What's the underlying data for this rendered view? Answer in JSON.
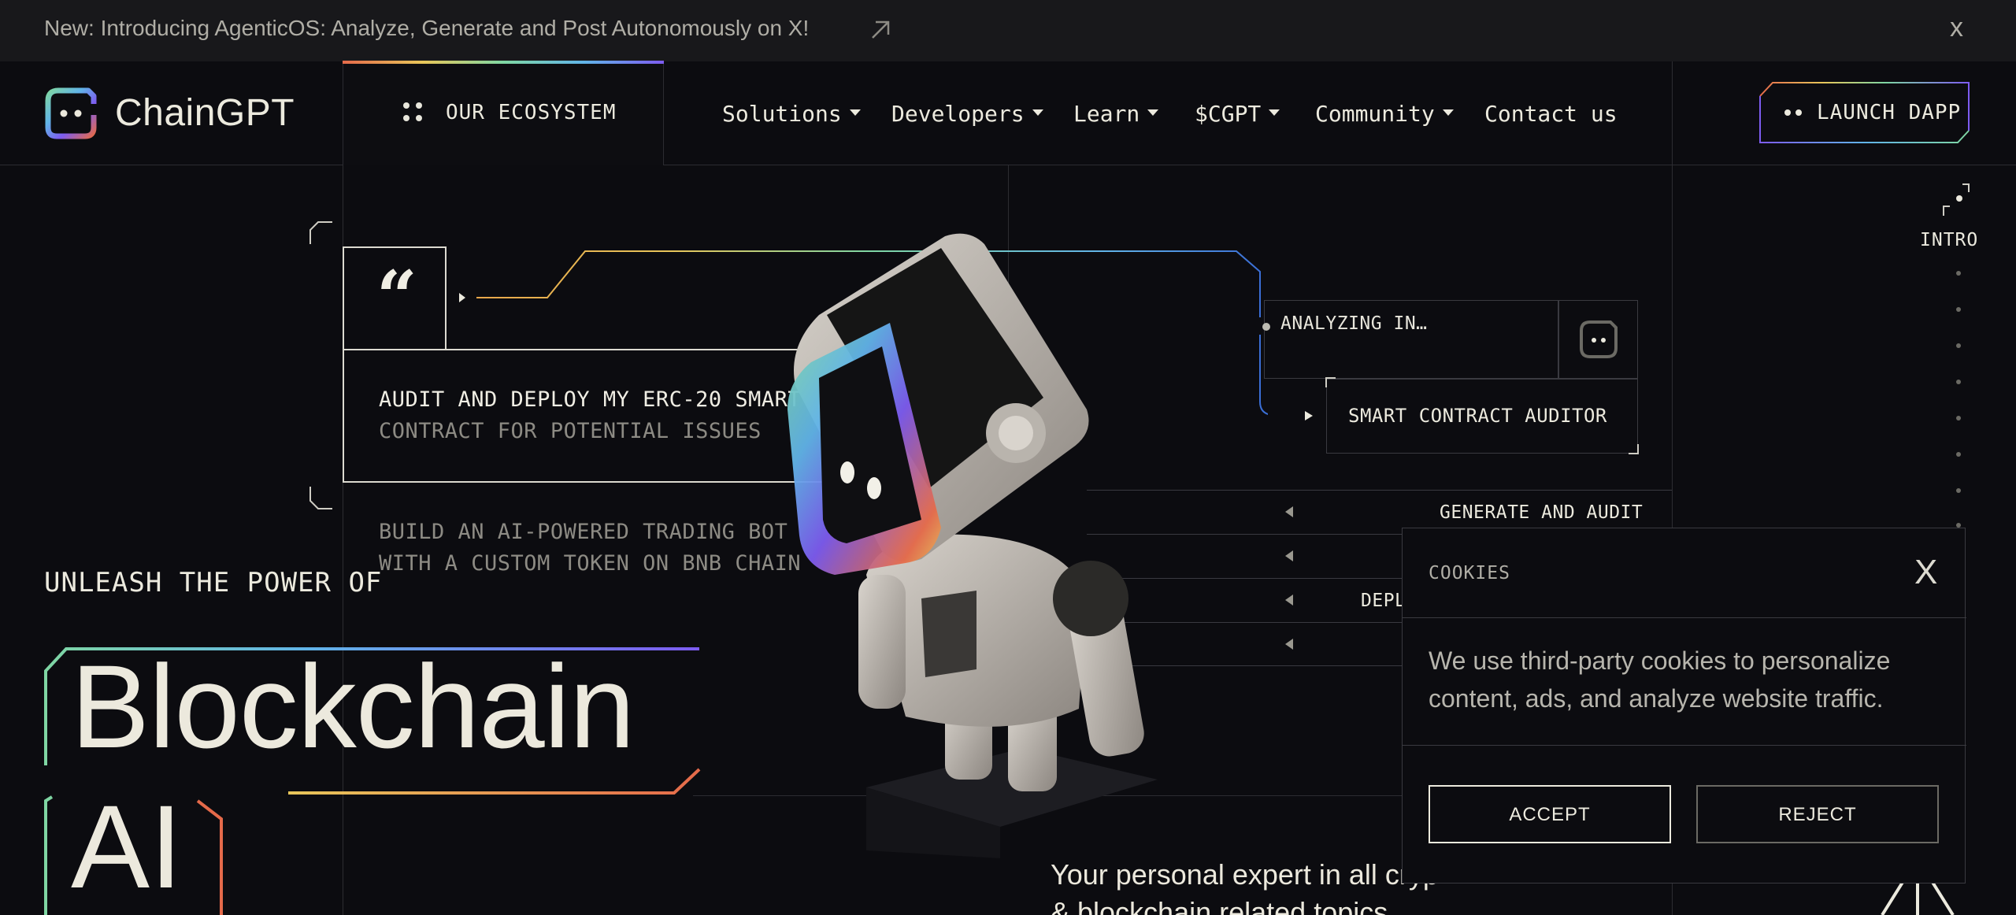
{
  "announcement": {
    "text": "New: Introducing AgenticOS: Analyze, Generate and Post Autonomously on X!",
    "close_label": "x"
  },
  "nav": {
    "brand": "ChainGPT",
    "ecosystem_label": "OUR ECOSYSTEM",
    "items": [
      {
        "label": "Solutions",
        "has_caret": true
      },
      {
        "label": "Developers",
        "has_caret": true
      },
      {
        "label": "Learn",
        "has_caret": true
      },
      {
        "label": "$CGPT",
        "has_caret": true
      },
      {
        "label": "Community",
        "has_caret": true
      },
      {
        "label": "Contact us",
        "has_caret": false
      }
    ],
    "launch_label": "LAUNCH DAPP"
  },
  "prompts": {
    "active_line_1": "AUDIT AND DEPLOY MY ERC-20 SMART",
    "active_line_2": "CONTRACT FOR POTENTIAL ISSUES",
    "next_line_1": "BUILD AN AI-POWERED TRADING BOT",
    "next_line_2": "WITH A CUSTOM TOKEN ON BNB CHAIN"
  },
  "agent_panel": {
    "status": "ANALYZING IN…",
    "tool": "SMART CONTRACT AUDITOR",
    "options": [
      "GENERATE AND AUDIT",
      "",
      "DEPL",
      ""
    ]
  },
  "hero": {
    "kicker": "UNLEASH THE POWER OF",
    "line_1": "Blockchain",
    "line_2": "AI",
    "tagline_1": "Your personal expert in all cryp",
    "tagline_2": "& blockchain related topics"
  },
  "rail": {
    "label": "INTRO"
  },
  "cookies": {
    "title": "COOKIES",
    "close_label": "X",
    "message": "We use third-party cookies to personalize content, ads, and analyze website traffic.",
    "accept_label": "ACCEPT",
    "reject_label": "REJECT"
  },
  "colors": {
    "background": "#0c0c10",
    "text": "#eceade",
    "muted": "#8d8b84",
    "border": "#2c2c31",
    "gradient": [
      "#e56a4a",
      "#e8c65a",
      "#7fd6a3",
      "#61b4e8",
      "#7d5cf0"
    ]
  }
}
